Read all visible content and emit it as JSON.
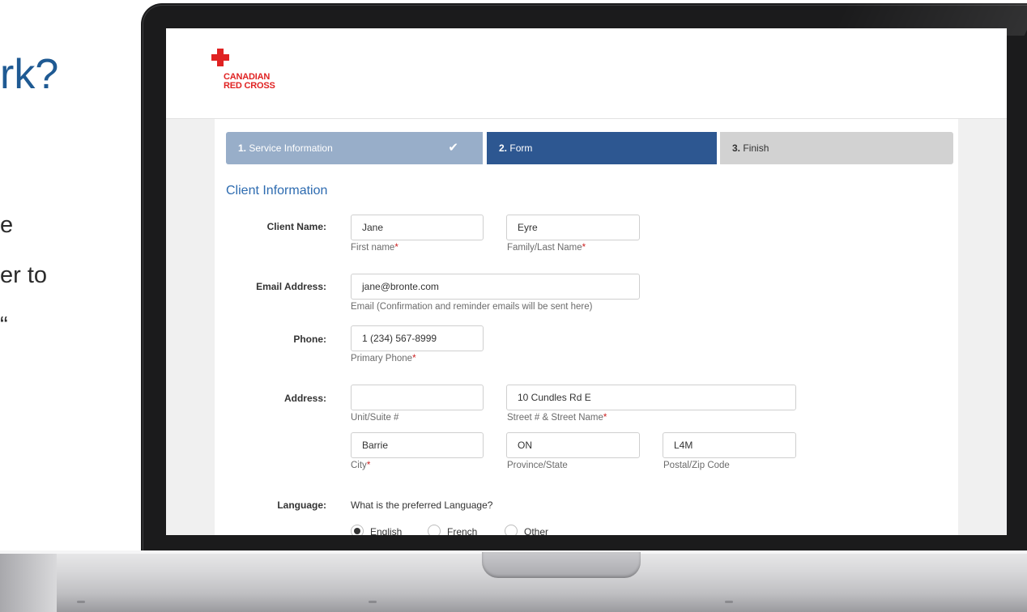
{
  "slide": {
    "title_fragment": "rk?",
    "line1": "e",
    "line2": "er to",
    "line3": "“"
  },
  "brand": {
    "logo_line1": "CANADIAN",
    "logo_line2": "RED CROSS",
    "color": "#e02222"
  },
  "stepper": {
    "steps": [
      {
        "number": "1.",
        "label": "Service Information",
        "state": "complete"
      },
      {
        "number": "2.",
        "label": "Form",
        "state": "active"
      },
      {
        "number": "3.",
        "label": "Finish",
        "state": "pending"
      }
    ]
  },
  "form": {
    "section_title": "Client Information",
    "client_name": {
      "label": "Client Name:",
      "first_value": "Jane",
      "first_hint": "First name",
      "last_value": "Eyre",
      "last_hint": "Family/Last Name"
    },
    "email": {
      "label": "Email Address:",
      "value": "jane@bronte.com",
      "hint": "Email (Confirmation and reminder emails will be sent here)"
    },
    "phone": {
      "label": "Phone:",
      "value": "1 (234) 567-8999",
      "hint": "Primary Phone"
    },
    "address": {
      "label": "Address:",
      "unit_value": "",
      "unit_hint": "Unit/Suite #",
      "street_value": "10 Cundles Rd E",
      "street_hint": "Street # & Street Name",
      "city_value": "Barrie",
      "city_hint": "City",
      "province_value": "ON",
      "province_hint": "Province/State",
      "postal_value": "L4M",
      "postal_hint": "Postal/Zip Code"
    },
    "language": {
      "label": "Language:",
      "question": "What is the preferred Language?",
      "options": [
        "English",
        "French",
        "Other"
      ],
      "selected": "English"
    },
    "required_mark": "*"
  },
  "colors": {
    "accent_blue": "#2d5791",
    "step_done": "#98aec9",
    "step_pending": "#d2d2d2",
    "section_title": "#2d6bb0"
  }
}
